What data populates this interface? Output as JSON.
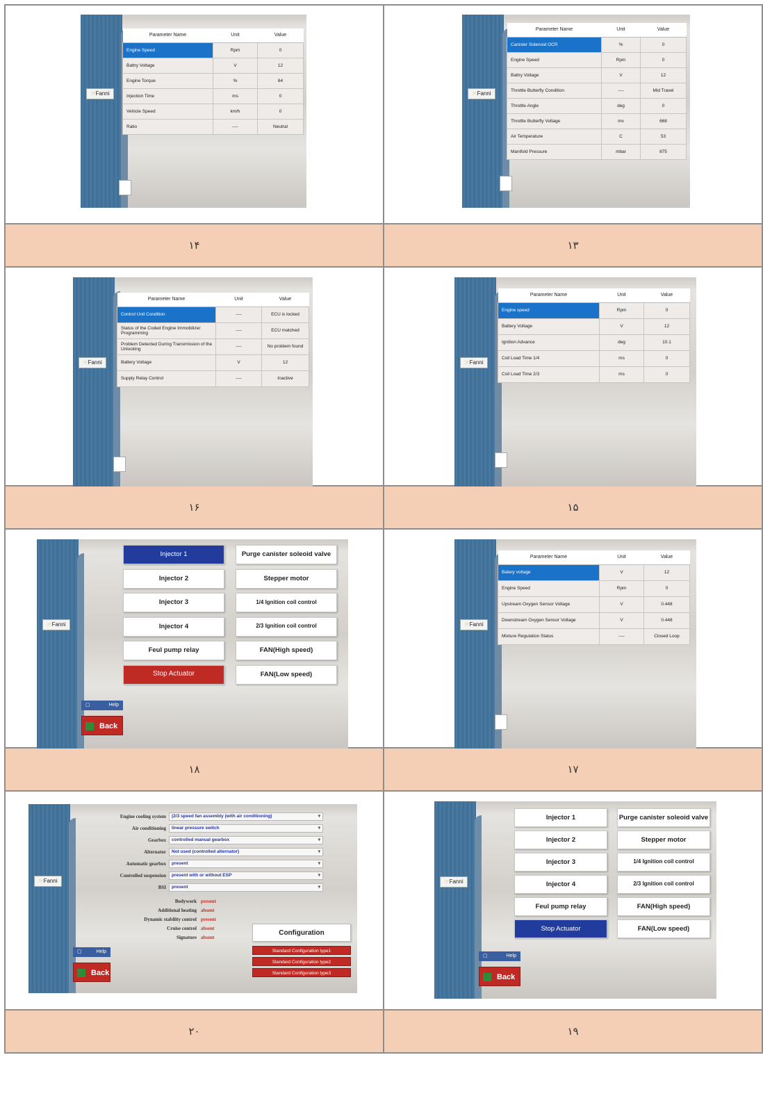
{
  "brand": "Fanni",
  "captions": [
    "۱۴",
    "۱۳",
    "۱۶",
    "۱۵",
    "۱۸",
    "۱۷",
    "۲۰",
    "۱۹"
  ],
  "table_header": {
    "name": "Parameter Name",
    "unit": "Unit",
    "value": "Value"
  },
  "fig14": {
    "rows": [
      [
        "Engine Speed",
        "Rpm",
        "0"
      ],
      [
        "Battry Voltage",
        "V",
        "12"
      ],
      [
        "Engine Torque",
        "%",
        "64"
      ],
      [
        "Injection Time",
        "ms",
        "0"
      ],
      [
        "Vehicle Speed",
        "km/h",
        "0"
      ],
      [
        "Ratio",
        "----",
        "Neutral"
      ]
    ]
  },
  "fig13": {
    "rows": [
      [
        "Canister Solenoid OCR",
        "%",
        "0"
      ],
      [
        "Engine Speed",
        "Rpm",
        "0"
      ],
      [
        "Battry Voltage",
        "V",
        "12"
      ],
      [
        "Throttle Butterfly Condition",
        "----",
        "Mid Travel"
      ],
      [
        "Throttle Angle",
        "deg",
        "0"
      ],
      [
        "Throttle Butterfly Voltage",
        "mv",
        "668"
      ],
      [
        "Air Temperature",
        "C",
        "53"
      ],
      [
        "Manifold Pressure",
        "mbar",
        "875"
      ]
    ]
  },
  "fig16": {
    "rows": [
      [
        "Control Unit Condition",
        "----",
        "ECU is locked"
      ],
      [
        "Status of the Coded Engine Immobilizer Programming",
        "----",
        "ECU matched"
      ],
      [
        "Problem Detected During Transmission of the Unlocking",
        "----",
        "No problem found"
      ],
      [
        "Battery Voltage",
        "V",
        "12"
      ],
      [
        "Supply Relay Control",
        "----",
        "Inactive"
      ]
    ]
  },
  "fig15": {
    "rows": [
      [
        "Engine speed",
        "Rpm",
        "0"
      ],
      [
        "Battery Voltage",
        "V",
        "12"
      ],
      [
        "Ignition Advance",
        "deg",
        "10.1"
      ],
      [
        "Coil Load Time 1/4",
        "ms",
        "0"
      ],
      [
        "Coil Load Time 2/3",
        "ms",
        "0"
      ]
    ]
  },
  "fig17": {
    "rows": [
      [
        "Batery voltage",
        "V",
        "12"
      ],
      [
        "Engine Speed",
        "Rpm",
        "0"
      ],
      [
        "Upstream Oxygen Sensor Voltage",
        "V",
        "0.448"
      ],
      [
        "Downstream Oxygen Sensor Voltage",
        "V",
        "0.448"
      ],
      [
        "Mixture Regulation Status",
        "----",
        "Closed Loop"
      ]
    ]
  },
  "actuators": {
    "left": [
      "Injector 1",
      "Injector 2",
      "Injector 3",
      "Injector 4",
      "Feul pump relay",
      "Stop Actuator"
    ],
    "right": [
      "Purge canister soleoid valve",
      "Stepper motor",
      "1/4 Ignition coil control",
      "2/3 Ignition coil control",
      "FAN(High speed)",
      "FAN(Low speed)"
    ],
    "help": "Help",
    "back": "Back"
  },
  "config": {
    "selects": [
      [
        "Engine cooling system",
        "(2/3 speed fan assembly (with air conditioning)"
      ],
      [
        "Air conditioning",
        "linear pressure switch"
      ],
      [
        "Gearbox",
        "controlled manual gearbox"
      ],
      [
        "Alternator",
        "Not used (controlled alternator)"
      ],
      [
        "Automatic gearbox",
        "present"
      ],
      [
        "Controlled suspension",
        "present with or without ESP"
      ],
      [
        "BSI",
        "present"
      ]
    ],
    "options": [
      [
        "Bodywork",
        "present"
      ],
      [
        "Additional heating",
        "absent"
      ],
      [
        "Dynamic stability control",
        "present"
      ],
      [
        "Cruise control",
        "absent"
      ],
      [
        "Signature",
        "absent"
      ]
    ],
    "configuration_button": "Configuration",
    "std_buttons": [
      "Standard Configuration type1",
      "Standard Configuration type2",
      "Standard Configuration type3"
    ]
  }
}
